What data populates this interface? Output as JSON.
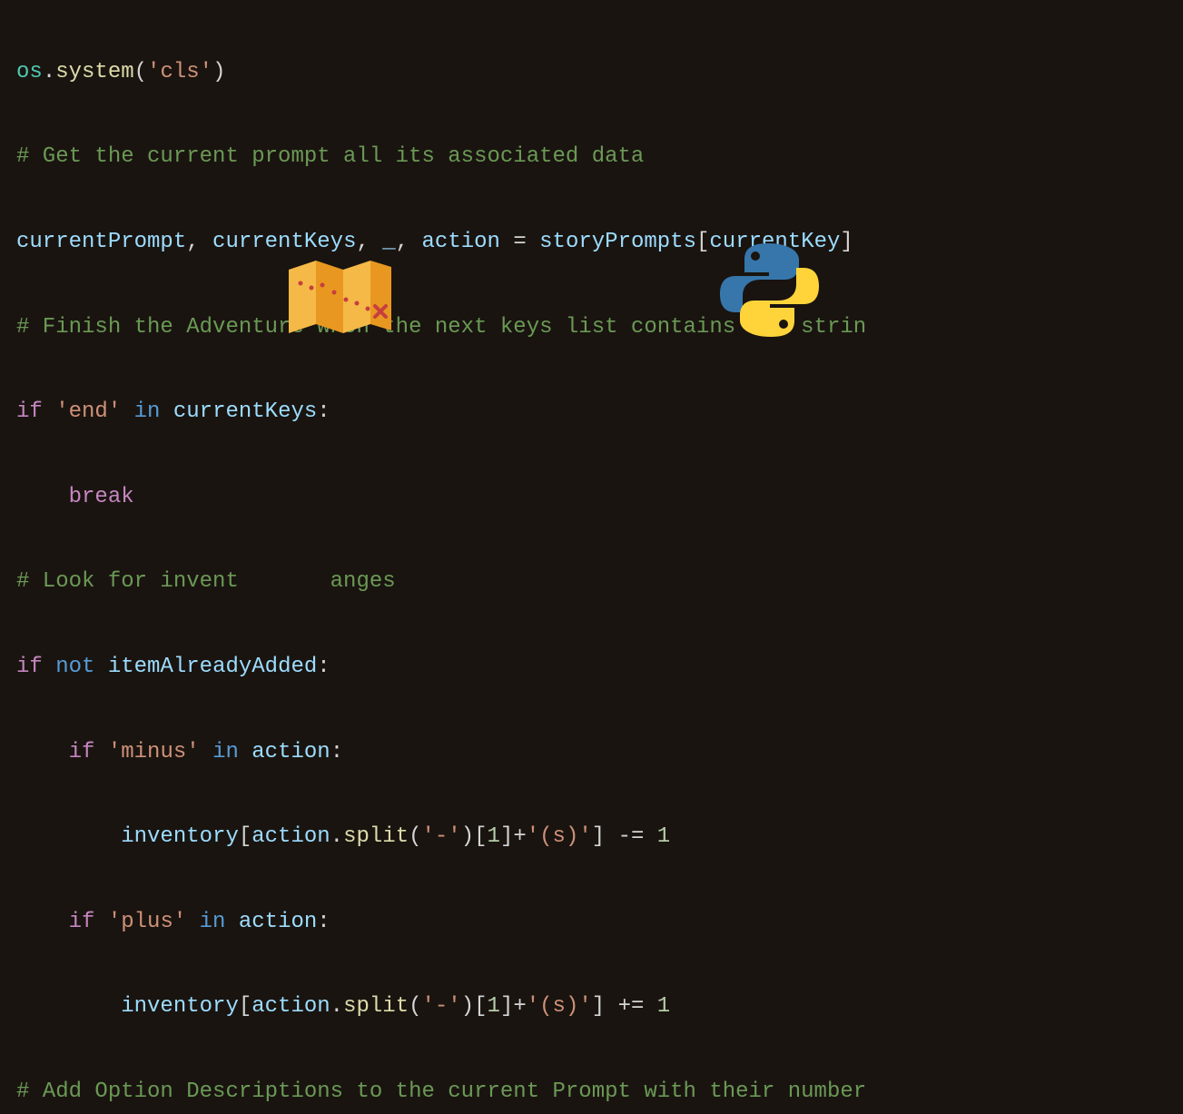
{
  "code": {
    "line1": {
      "os": "os",
      "dot": ".",
      "system": "system",
      "open": "(",
      "str": "'cls'",
      "close": ")"
    },
    "line2": {
      "comment": "# Get the current prompt all its associated data"
    },
    "line3": {
      "currentPrompt": "currentPrompt",
      "comma1": ", ",
      "currentKeys": "currentKeys",
      "comma2": ", ",
      "underscore": "_",
      "comma3": ", ",
      "action": "action",
      "equals": " = ",
      "storyPrompts": "storyPrompts",
      "open": "[",
      "currentKey": "currentKey",
      "close": "]"
    },
    "line4": {
      "comment": "# Finish the Adventure when the next keys list contains the strin"
    },
    "line5": {
      "if": "if",
      "space1": " ",
      "str": "'end'",
      "space2": " ",
      "in": "in",
      "space3": " ",
      "currentKeys": "currentKeys",
      "colon": ":"
    },
    "line6": {
      "indent": "    ",
      "break": "break"
    },
    "line7": {
      "comment": "# Look for invent       anges"
    },
    "line8": {
      "if": "if",
      "space1": " ",
      "not": "not",
      "space2": " ",
      "itemAlreadyAdded": "itemAlreadyAdded",
      "colon": ":"
    },
    "line9": {
      "indent": "    ",
      "if": "if",
      "space1": " ",
      "str": "'minus'",
      "space2": " ",
      "in": "in",
      "space3": " ",
      "action": "action",
      "colon": ":"
    },
    "line10": {
      "indent": "        ",
      "inventory": "inventory",
      "open": "[",
      "action": "action",
      "dot": ".",
      "split": "split",
      "popen": "(",
      "dash": "'-'",
      "pclose": ")",
      "bopen": "[",
      "one": "1",
      "bclose": "]",
      "plus": "+",
      "s": "'(s)'",
      "close": "]",
      "op": " -= ",
      "val": "1"
    },
    "line11": {
      "indent": "    ",
      "if": "if",
      "space1": " ",
      "str": "'plus'",
      "space2": " ",
      "in": "in",
      "space3": " ",
      "action": "action",
      "colon": ":"
    },
    "line12": {
      "indent": "        ",
      "inventory": "inventory",
      "open": "[",
      "action": "action",
      "dot": ".",
      "split": "split",
      "popen": "(",
      "dash": "'-'",
      "pclose": ")",
      "bopen": "[",
      "one": "1",
      "bclose": "]",
      "plus": "+",
      "s": "'(s)'",
      "close": "]",
      "op": " += ",
      "val": "1"
    },
    "line13": {
      "comment": "# Add Option Descriptions to the current Prompt with their number"
    }
  },
  "icons": {
    "map": "treasure-map",
    "python": "python-logo"
  }
}
